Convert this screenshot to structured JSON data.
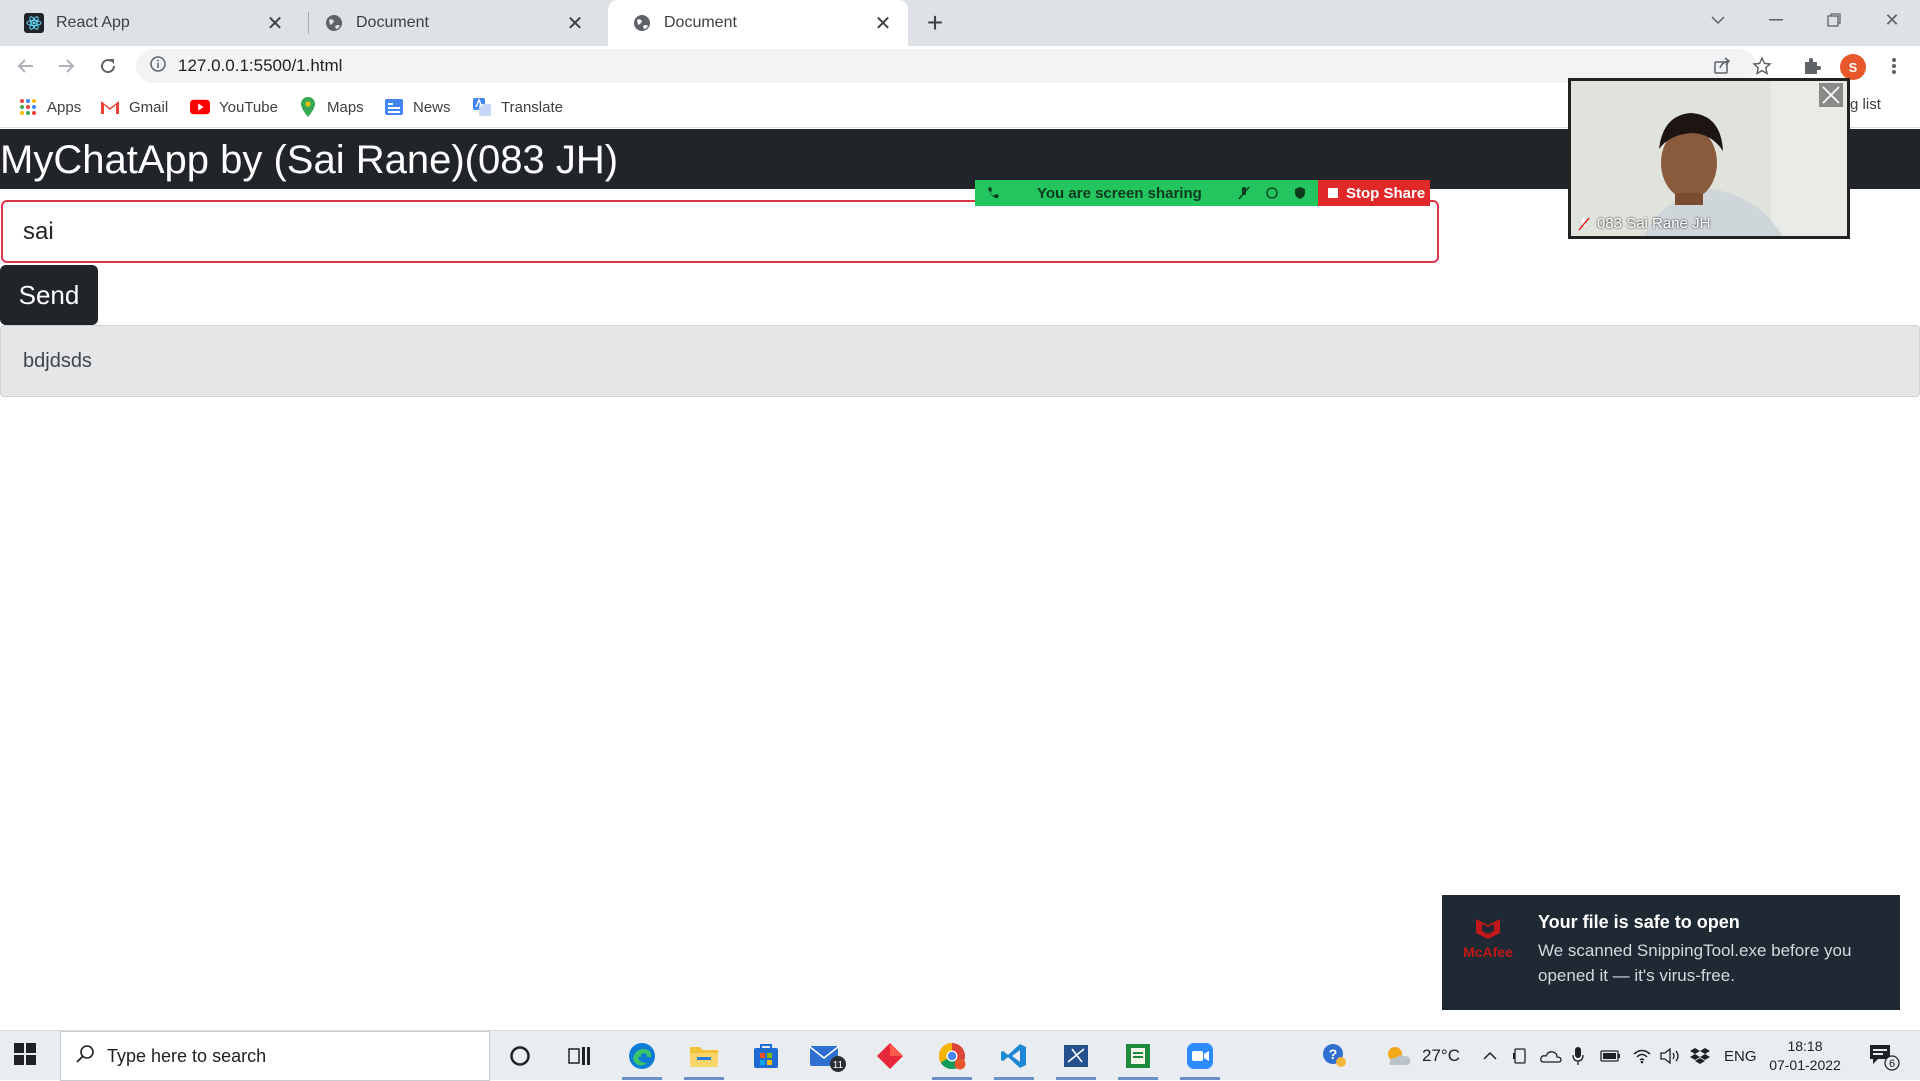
{
  "browser": {
    "tabs": [
      {
        "title": "React App",
        "active": false
      },
      {
        "title": "Document",
        "active": false
      },
      {
        "title": "Document",
        "active": true
      }
    ],
    "url": "127.0.0.1:5500/1.html",
    "profile_initial": "S",
    "bookmarks": [
      "Apps",
      "Gmail",
      "YouTube",
      "Maps",
      "News",
      "Translate"
    ],
    "reading_list": "ding list"
  },
  "app": {
    "brand": "MyChatApp by (Sai Rane)(083 JH)",
    "input_value": "sai",
    "send_label": "Send",
    "messages": [
      "bdjdsds"
    ],
    "input_border_color": "#dc3545",
    "navbar_color": "#212529"
  },
  "zoom": {
    "share_text": "You are screen sharing",
    "stop_label": "Stop Share",
    "participant_name": "083 Sai Rane JH",
    "share_color": "#22c55e",
    "stop_color": "#e02828"
  },
  "toast": {
    "brand": "McAfee",
    "title": "Your file is safe to open",
    "body": "We scanned SnippingTool.exe before you opened it — it's virus-free."
  },
  "taskbar": {
    "search_placeholder": "Type here to search",
    "mail_badge": "11",
    "temperature": "27°C",
    "language": "ENG",
    "time": "18:18",
    "date": "07-01-2022",
    "notification_count": "6"
  }
}
